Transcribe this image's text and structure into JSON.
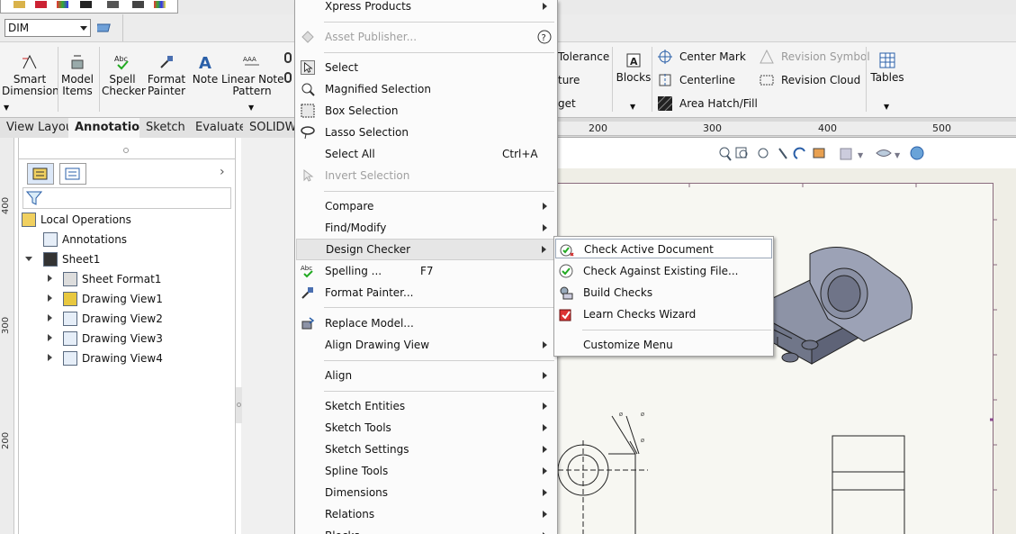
{
  "layer_combo": {
    "value": "DIM"
  },
  "ribbon": {
    "smart_dimension": "Smart\nDimension",
    "model_items": "Model\nItems",
    "spell_checker": "Spell\nChecker",
    "format_painter": "Format\nPainter",
    "note": "Note",
    "linear_note_pattern": "Linear Note\nPattern",
    "tolerance": "Tolerance",
    "ture": "ture",
    "get": "get",
    "blocks": "Blocks",
    "center_mark": "Center Mark",
    "centerline": "Centerline",
    "area_hatch": "Area Hatch/Fill",
    "revision_symbol": "Revision Symbol",
    "revision_cloud": "Revision Cloud",
    "tables": "Tables"
  },
  "tabs": [
    "View Layout",
    "Annotation",
    "Sketch",
    "Evaluate",
    "SOLIDWO"
  ],
  "rulers": {
    "left": [
      "400",
      "300",
      "200"
    ],
    "top": [
      "200",
      "300",
      "400",
      "500"
    ]
  },
  "tree": {
    "items": [
      {
        "label": "Local Operations"
      },
      {
        "label": "Annotations"
      },
      {
        "label": "Sheet1"
      },
      {
        "label": "Sheet Format1"
      },
      {
        "label": "Drawing View1"
      },
      {
        "label": "Drawing View2"
      },
      {
        "label": "Drawing View3"
      },
      {
        "label": "Drawing View4"
      }
    ]
  },
  "menu": {
    "items": [
      {
        "label": "Xpress Products"
      },
      {
        "label": "Asset Publisher..."
      },
      {
        "label": "Select"
      },
      {
        "label": "Magnified Selection"
      },
      {
        "label": "Box Selection"
      },
      {
        "label": "Lasso Selection"
      },
      {
        "label": "Select All",
        "shortcut": "Ctrl+A"
      },
      {
        "label": "Invert Selection"
      },
      {
        "label": "Compare"
      },
      {
        "label": "Find/Modify"
      },
      {
        "label": "Design Checker"
      },
      {
        "label": "Spelling ...",
        "shortcut": "F7"
      },
      {
        "label": "Format Painter..."
      },
      {
        "label": "Replace Model..."
      },
      {
        "label": "Align Drawing View"
      },
      {
        "label": "Align"
      },
      {
        "label": "Sketch Entities"
      },
      {
        "label": "Sketch Tools"
      },
      {
        "label": "Sketch Settings"
      },
      {
        "label": "Spline Tools"
      },
      {
        "label": "Dimensions"
      },
      {
        "label": "Relations"
      },
      {
        "label": "Blocks"
      }
    ]
  },
  "submenu": {
    "items": [
      {
        "label": "Check Active Document"
      },
      {
        "label": "Check Against Existing File..."
      },
      {
        "label": "Build Checks"
      },
      {
        "label": "Learn Checks Wizard"
      },
      {
        "label": "Customize Menu"
      }
    ]
  },
  "colors": {
    "accent": "#3a72c4",
    "sheet_border": "#8a6b7d",
    "part": "#8d93a6"
  }
}
